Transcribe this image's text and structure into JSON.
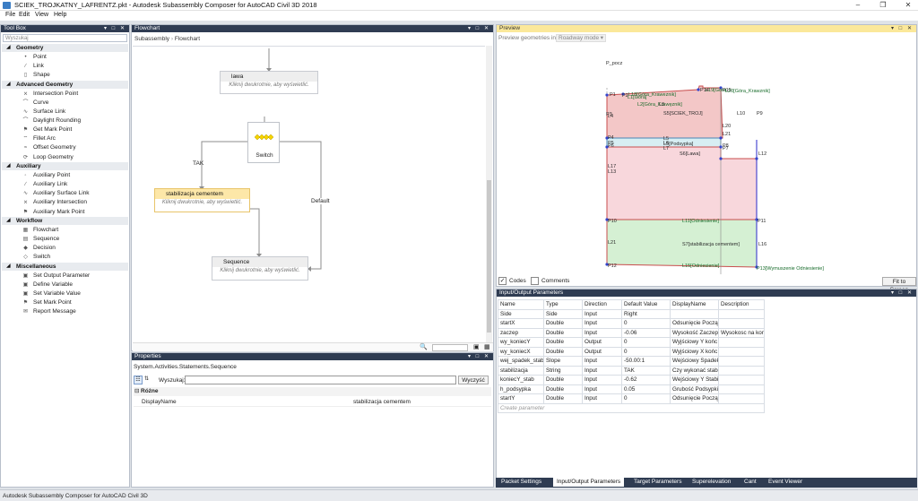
{
  "window": {
    "title": "SCIEK_TROJKATNY_LAFRENTZ.pkt - Autodesk Subassembly Composer for AutoCAD Civil 3D 2018"
  },
  "menu": [
    "File",
    "Edit",
    "View",
    "Help"
  ],
  "toolbox": {
    "title": "Tool Box",
    "search_placeholder": "Wyszukaj",
    "categories": [
      {
        "name": "Geometry",
        "items": [
          "Point",
          "Link",
          "Shape"
        ]
      },
      {
        "name": "Advanced Geometry",
        "items": [
          "Intersection Point",
          "Curve",
          "Surface Link",
          "Daylight Rounding",
          "Get Mark Point",
          "Fillet Arc",
          "Offset Geometry",
          "Loop Geometry"
        ]
      },
      {
        "name": "Auxiliary",
        "items": [
          "Auxiliary Point",
          "Auxiliary Link",
          "Auxiliary Surface Link",
          "Auxiliary Intersection",
          "Auxiliary Mark Point"
        ]
      },
      {
        "name": "Workflow",
        "items": [
          "Flowchart",
          "Sequence",
          "Decision",
          "Switch"
        ]
      },
      {
        "name": "Miscellaneous",
        "items": [
          "Set Output Parameter",
          "Define Variable",
          "Set Variable Value",
          "Set Mark Point",
          "Report Message"
        ]
      }
    ]
  },
  "flowchart": {
    "title": "Flowchart",
    "breadcrumb": [
      "Subassembly",
      "Flowchart"
    ],
    "nodes": {
      "lawa": {
        "title": "lawa",
        "hint": "Kliknij dwukrotnie, aby wyświetlić."
      },
      "switch": {
        "title": "Switch"
      },
      "stab": {
        "title": "stabilizacja cementem",
        "hint": "Kliknij dwukrotnie, aby wyświetlić."
      },
      "seq": {
        "title": "Sequence",
        "hint": "Kliknij dwukrotnie, aby wyświetlić."
      }
    },
    "edge_labels": {
      "tak": "TAK",
      "default": "Default"
    }
  },
  "properties": {
    "title": "Properties",
    "type": "System.Activities.Statements.Sequence",
    "search_label": "Wyszukaj:",
    "clear_button": "Wyczyść",
    "group": "Różne",
    "rows": [
      {
        "name": "DisplayName",
        "value": "stabilizacja cementem"
      }
    ]
  },
  "preview": {
    "title": "Preview",
    "geom_label": "Preview geometries in",
    "mode": "Roadway mode",
    "codes_label": "Codes",
    "comments_label": "Comments",
    "codes_checked": true,
    "comments_checked": false,
    "fit_button": "Fit to Screen",
    "labels": [
      "P_pocz",
      "P1",
      "P2",
      "L1[Góra]",
      "L18[Góra_Kraweznik]",
      "P14",
      "L19[Góra",
      "P15",
      "L20[Góra_Krawznik]",
      "L2[Góra_Krawęznik]",
      "L3",
      "S5[SCIEK_TROJ]",
      "L10",
      "P9",
      "P3",
      "L4",
      "L20",
      "L21",
      "P4",
      "P5",
      "L5",
      "L6",
      "L5[Podsypka]",
      "P6",
      "P8",
      "P7",
      "L7",
      "S6[Lawa]",
      "L12",
      "L17",
      "L13",
      "P10",
      "L11[Odniesienie]",
      "P11",
      "L21",
      "S7[stabilizacja cementem]",
      "L16",
      "P12",
      "L15[Odniesienie]",
      "P13[Wymuszenie Odniesienie]"
    ]
  },
  "io": {
    "title": "Input/Output Parameters",
    "columns": [
      "Name",
      "Type",
      "Direction",
      "Default Value",
      "DisplayName",
      "Description"
    ],
    "rows": [
      [
        "Side",
        "Side",
        "Input",
        "Right",
        "",
        ""
      ],
      [
        "startX",
        "Double",
        "Input",
        "0",
        "Odsunięcie Począt",
        ""
      ],
      [
        "zaczep",
        "Double",
        "Input",
        "-0.06",
        "Wysokość Zaczep",
        "Wysokosc na konc"
      ],
      [
        "wy_koniecY",
        "Double",
        "Output",
        "0",
        "Wyjściowy Y końc",
        ""
      ],
      [
        "wy_koniecX",
        "Double",
        "Output",
        "0",
        "Wyjściowy X końc",
        ""
      ],
      [
        "wej_spadek_stab",
        "Slope",
        "Input",
        "-50.00:1",
        "Wejściowy Spadek",
        ""
      ],
      [
        "stabilizacja",
        "String",
        "Input",
        "TAK",
        "Czy  wykonać stab",
        ""
      ],
      [
        "koniecY_stab",
        "Double",
        "Input",
        "-0.62",
        "Wejściowy Y Stabi",
        ""
      ],
      [
        "h_podsypka",
        "Double",
        "Input",
        "0.05",
        "Grubość Podsypki",
        ""
      ],
      [
        "startY",
        "Double",
        "Input",
        "0",
        "Odsunięcie Począt",
        ""
      ]
    ],
    "create_placeholder": "Create parameter"
  },
  "bottom_tabs": [
    "Packet Settings",
    "Input/Output Parameters",
    "Target Parameters",
    "Superelevation",
    "Cant",
    "Event Viewer"
  ],
  "active_tab": "Input/Output Parameters",
  "status": "Autodesk Subassembly Composer for AutoCAD Civil 3D"
}
